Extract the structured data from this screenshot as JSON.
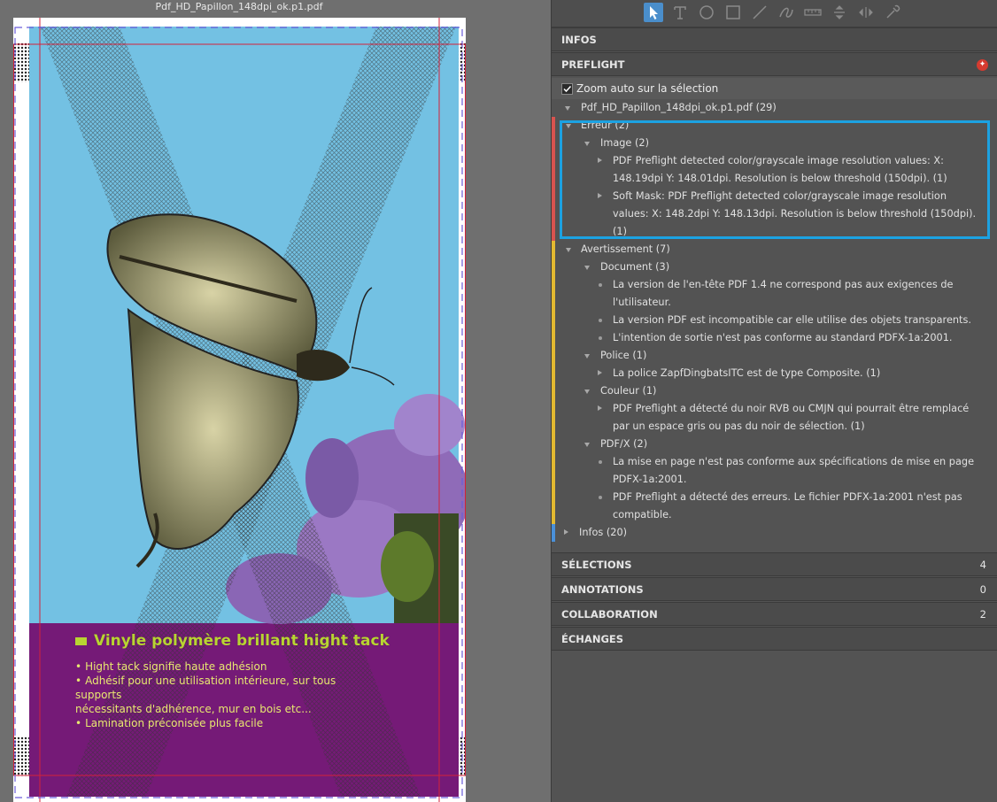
{
  "document": {
    "title": "Pdf_HD_Papillon_148dpi_ok.p1.pdf",
    "artwork": {
      "product_title": "Vinyle polymère brillant hight tack",
      "features": [
        "Hight tack signifie haute adhésion",
        "Adhésif pour une utilisation intérieure, sur tous supports",
        "nécessitants d'adhérence, mur en bois etc...",
        "Lamination préconisée plus facile"
      ],
      "colors": {
        "sky": "#73c1e3",
        "band": "#751a77",
        "accent": "#b8d432"
      }
    }
  },
  "toolbar": {
    "tools": [
      "cursor-icon",
      "text-icon",
      "ellipse-icon",
      "rectangle-icon",
      "line-icon",
      "freehand-icon",
      "ruler-icon",
      "vertical-align-icon",
      "horizontal-align-icon",
      "eyedropper-icon"
    ],
    "active_tool": "cursor-icon"
  },
  "sections": {
    "infos": "INFOS",
    "preflight": "PREFLIGHT",
    "selections": {
      "label": "SÉLECTIONS",
      "count": "4"
    },
    "annotations": {
      "label": "ANNOTATIONS",
      "count": "0"
    },
    "collaboration": {
      "label": "COLLABORATION",
      "count": "2"
    },
    "echanges": "ÉCHANGES"
  },
  "preflight": {
    "zoom_auto_label": "Zoom auto sur la sélection",
    "zoom_auto_checked": true,
    "file_node": "Pdf_HD_Papillon_148dpi_ok.p1.pdf (29)",
    "erreur": {
      "label": "Erreur (2)",
      "image": {
        "label": "Image (2)",
        "items": [
          "PDF Preflight detected color/grayscale image resolution values: X: 148.19dpi Y: 148.01dpi. Resolution is below threshold (150dpi). (1)",
          "Soft Mask: PDF Preflight detected color/grayscale image resolution values: X: 148.2dpi Y: 148.13dpi. Resolution is below threshold (150dpi). (1)"
        ]
      }
    },
    "avertissement": {
      "label": "Avertissement (7)",
      "document": {
        "label": "Document (3)",
        "items": [
          "La version de l'en-tête PDF 1.4 ne correspond pas aux exigences de l'utilisateur.",
          "La version PDF est incompatible car elle utilise des objets transparents.",
          "L'intention de sortie n'est pas conforme au standard PDFX-1a:2001."
        ]
      },
      "police": {
        "label": "Police (1)",
        "items": [
          "La police ZapfDingbatsITC est de type Composite. (1)"
        ]
      },
      "couleur": {
        "label": "Couleur (1)",
        "items": [
          "PDF Preflight a détecté du noir RVB ou CMJN qui pourrait être remplacé par un espace gris ou pas du noir de sélection. (1)"
        ]
      },
      "pdfx": {
        "label": "PDF/X (2)",
        "items": [
          "La mise en page n'est pas conforme aux spécifications de mise en page PDFX-1a:2001.",
          "PDF Preflight a détecté des erreurs. Le fichier PDFX-1a:2001 n'est pas compatible."
        ]
      }
    },
    "infos": {
      "label": "Infos (20)"
    },
    "colors": {
      "error": "#d9534f",
      "warning": "#e3b931",
      "info": "#4a90d9",
      "highlight": "#1ca2e2"
    }
  }
}
